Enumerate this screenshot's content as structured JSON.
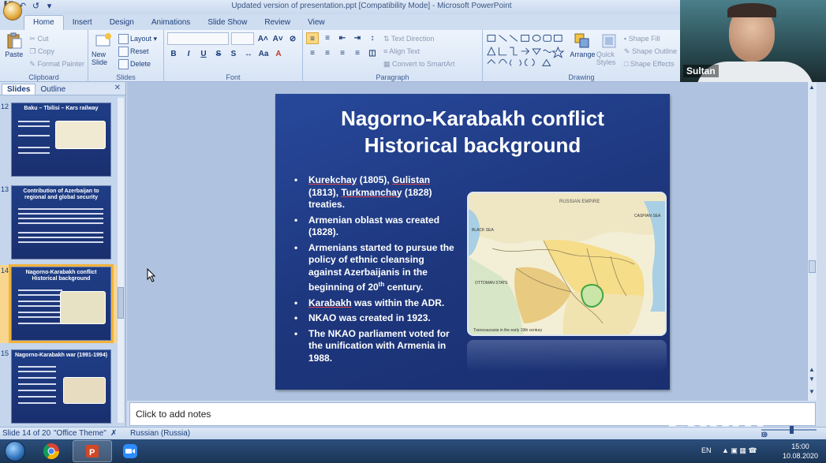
{
  "window": {
    "title": "Updated version of presentation.ppt [Compatibility Mode] - Microsoft PowerPoint"
  },
  "ribbon": {
    "tabs": [
      "Home",
      "Insert",
      "Design",
      "Animations",
      "Slide Show",
      "Review",
      "View"
    ],
    "active_tab": "Home",
    "clipboard": {
      "label": "Clipboard",
      "paste": "Paste",
      "cut": "Cut",
      "copy": "Copy",
      "format_painter": "Format Painter"
    },
    "slides": {
      "label": "Slides",
      "new_slide": "New Slide",
      "layout": "Layout",
      "reset": "Reset",
      "delete": "Delete"
    },
    "font": {
      "label": "Font"
    },
    "paragraph": {
      "label": "Paragraph",
      "text_direction": "Text Direction",
      "align_text": "Align Text",
      "convert_smartart": "Convert to SmartArt"
    },
    "drawing": {
      "label": "Drawing",
      "arrange": "Arrange",
      "quick_styles": "Quick Styles",
      "shape_fill": "Shape Fill",
      "shape_outline": "Shape Outline",
      "shape_effects": "Shape Effects"
    }
  },
  "webcam": {
    "name": "Sultan"
  },
  "slides_panel": {
    "tabs": [
      "Slides",
      "Outline"
    ],
    "thumbnails": [
      {
        "number": "12",
        "title": "Baku – Tbilisi – Kars railway",
        "selected": false
      },
      {
        "number": "13",
        "title": "Contribution of Azerbaijan to regional and global security",
        "selected": false
      },
      {
        "number": "14",
        "title": "Nagorno-Karabakh conflict Historical background",
        "selected": true
      },
      {
        "number": "15",
        "title": "Nagorno-Karabakh war (1991-1994)",
        "selected": false
      }
    ]
  },
  "slide": {
    "title_line1": "Nagorno-Karabakh conflict",
    "title_line2": "Historical background",
    "bullets": {
      "b1": {
        "t1": "Kurekchay",
        "t2": " (1805), ",
        "t3": "Gulistan",
        "t4": " (1813), ",
        "t5": "Turkmanchay",
        "t6": " (1828) treaties."
      },
      "b2": "Armenian oblast was created (1828).",
      "b3": {
        "pre": "Armenians started to pursue the policy of ethnic cleansing against Azerbaijanis in the beginning of 20",
        "sup": "th",
        "post": " century."
      },
      "b4": {
        "u": "Karabakh",
        "rest": " was within the ADR."
      },
      "b5": "NKAO was created in 1923.",
      "b6": "The NKAO parliament voted for the unification with Armenia in 1988."
    },
    "map_labels": {
      "russian_empire": "RUSSIAN EMPIRE",
      "black_sea": "BLACK SEA",
      "caspian_sea": "CASPIAN SEA",
      "ottoman_state": "OTTOMAN STATE",
      "caption": "Transcaucasia in the early 19th century"
    }
  },
  "notes": {
    "placeholder": "Click to add notes"
  },
  "zoom_watermark": "zoom",
  "status": {
    "slide_info": "Slide 14 of 20",
    "theme": "\"Office Theme\"",
    "language": "Russian (Russia)"
  },
  "taskbar": {
    "lang": "EN",
    "time": "15:00",
    "date": "10.08.2020"
  }
}
